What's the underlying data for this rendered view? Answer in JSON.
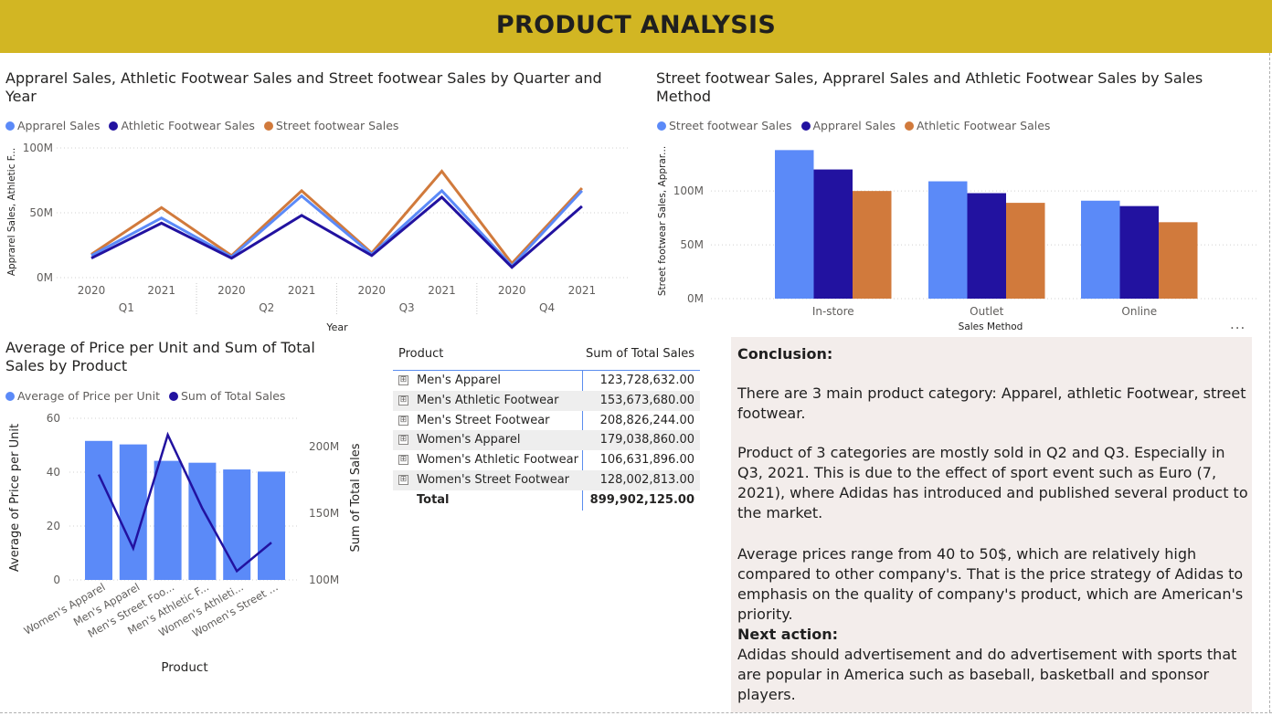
{
  "header": {
    "title": "PRODUCT ANALYSIS"
  },
  "colors": {
    "header_bg": "#d2b623",
    "light_blue": "#5b8af8",
    "navy": "#2212a0",
    "orange": "#d17a3c"
  },
  "line_visual": {
    "title": "Apprarel Sales, Athletic Footwear Sales and Street footwear Sales by Quarter and Year",
    "legend": [
      "Apprarel Sales",
      "Athletic Footwear Sales",
      "Street footwear Sales"
    ],
    "ylabel": "Apprarel Sales, Athletic F...",
    "xlabel": "Year"
  },
  "bar_visual": {
    "title": "Street footwear Sales, Apprarel Sales and Athletic Footwear Sales by Sales Method",
    "legend": [
      "Street footwear Sales",
      "Apprarel Sales",
      "Athletic Footwear Sales"
    ],
    "ylabel": "Street footwear Sales, Apprar...",
    "xlabel": "Sales Method",
    "more_icon": "..."
  },
  "combo_visual": {
    "title": "Average of Price per Unit and Sum of Total Sales by Product",
    "legend": [
      "Average of Price per Unit",
      "Sum of Total Sales"
    ],
    "ylabel_left": "Average of Price per Unit",
    "ylabel_right": "Sum of Total Sales",
    "xlabel": "Product"
  },
  "chart_data": [
    {
      "type": "line",
      "title": "Apprarel Sales, Athletic Footwear Sales and Street footwear Sales by Quarter and Year",
      "xlabel": "Year",
      "ylabel": "Apprarel Sales, Athletic F...",
      "x": [
        "2020",
        "2021",
        "2020",
        "2021",
        "2020",
        "2021",
        "2020",
        "2021"
      ],
      "x_groups": [
        "Q1",
        "Q2",
        "Q3",
        "Q4"
      ],
      "y_ticks": [
        "0M",
        "50M",
        "100M"
      ],
      "ylim": [
        0,
        100000000
      ],
      "grid": true,
      "legend_position": "top-left",
      "series": [
        {
          "name": "Apprarel Sales",
          "color": "#5b8af8",
          "values": [
            17000000,
            46000000,
            16000000,
            63000000,
            18000000,
            67000000,
            9000000,
            67000000
          ]
        },
        {
          "name": "Athletic Footwear Sales",
          "color": "#2212a0",
          "values": [
            15000000,
            42000000,
            15000000,
            48000000,
            17000000,
            62000000,
            8000000,
            55000000
          ]
        },
        {
          "name": "Street footwear Sales",
          "color": "#d17a3c",
          "values": [
            18000000,
            54000000,
            17000000,
            67000000,
            19000000,
            82000000,
            11000000,
            69000000
          ]
        }
      ]
    },
    {
      "type": "bar",
      "title": "Street footwear Sales, Apprarel Sales and Athletic Footwear Sales by Sales Method",
      "xlabel": "Sales Method",
      "ylabel": "Street footwear Sales, Apprar...",
      "categories": [
        "In-store",
        "Outlet",
        "Online"
      ],
      "y_ticks": [
        "0M",
        "50M",
        "100M"
      ],
      "ylim": [
        0,
        140000000
      ],
      "grid": true,
      "legend_position": "top-left",
      "series": [
        {
          "name": "Street footwear Sales",
          "color": "#5b8af8",
          "values": [
            138000000,
            109000000,
            91000000
          ]
        },
        {
          "name": "Apprarel Sales",
          "color": "#2212a0",
          "values": [
            120000000,
            98000000,
            86000000
          ]
        },
        {
          "name": "Athletic Footwear Sales",
          "color": "#d17a3c",
          "values": [
            100000000,
            89000000,
            71000000
          ]
        }
      ]
    },
    {
      "type": "bar",
      "title": "Average of Price per Unit and Sum of Total Sales by Product",
      "xlabel": "Product",
      "categories": [
        "Women's Apparel",
        "Men's Apparel",
        "Men's Street Foo...",
        "Men's Athletic F...",
        "Women's Athleti...",
        "Women's Street ..."
      ],
      "left_axis": {
        "label": "Average of Price per Unit",
        "ticks": [
          "0",
          "20",
          "40",
          "60"
        ],
        "range": [
          0,
          60
        ]
      },
      "right_axis": {
        "label": "Sum of Total Sales",
        "ticks": [
          "100M",
          "150M",
          "200M"
        ],
        "range": [
          100000000,
          210000000
        ]
      },
      "legend_position": "top-left",
      "series": [
        {
          "name": "Average of Price per Unit",
          "type": "bar",
          "axis": "left",
          "color": "#5b8af8",
          "values": [
            51.6,
            50.3,
            44.2,
            43.5,
            41.0,
            40.2
          ]
        },
        {
          "name": "Sum of Total Sales",
          "type": "line",
          "axis": "right",
          "color": "#2212a0",
          "values": [
            179038860,
            123728632,
            208826244,
            153673680,
            106631896,
            128002813
          ]
        }
      ]
    }
  ],
  "table": {
    "headers": [
      "Product",
      "Sum of Total Sales"
    ],
    "rows": [
      {
        "product": "Men's Apparel",
        "sales": "123,728,632.00"
      },
      {
        "product": "Men's Athletic Footwear",
        "sales": "153,673,680.00"
      },
      {
        "product": "Men's Street Footwear",
        "sales": "208,826,244.00"
      },
      {
        "product": "Women's Apparel",
        "sales": "179,038,860.00"
      },
      {
        "product": "Women's Athletic Footwear",
        "sales": "106,631,896.00"
      },
      {
        "product": "Women's Street Footwear",
        "sales": "128,002,813.00"
      }
    ],
    "total_label": "Total",
    "total_value": "899,902,125.00",
    "expand_icon": "⊞"
  },
  "conclusion": {
    "heading": "Conclusion:",
    "p1": "There are 3 main product category: Apparel, athletic Footwear, street footwear.",
    "p2": "Product of 3 categories are mostly sold in Q2 and Q3. Especially in Q3, 2021. This is due to the effect of sport event such as Euro (7, 2021), where Adidas has introduced and published several product to the market.",
    "p3": "Average prices range from 40 to 50$, which are relatively high compared to other company's. That is the price strategy of Adidas to emphasis on the quality of company's product, which are American's priority.",
    "next_heading": "Next action:",
    "p4": "Adidas should advertisement and do advertisement with sports that are popular in America such as baseball, basketball and sponsor players."
  }
}
